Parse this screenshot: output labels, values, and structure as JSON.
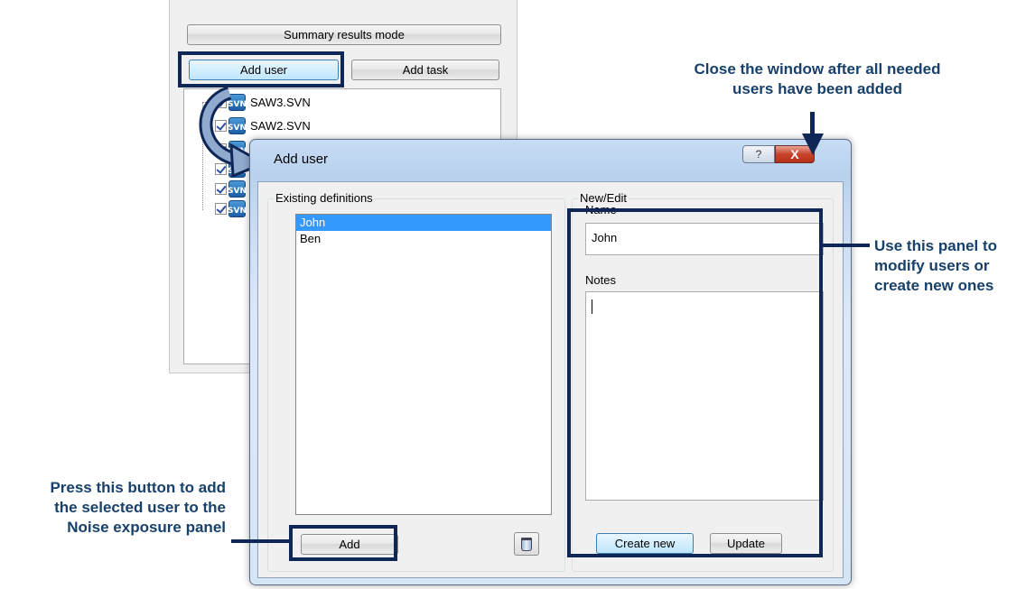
{
  "background_panel": {
    "summary_button": "Summary results mode",
    "add_user_button": "Add user",
    "add_task_button": "Add task",
    "tree_items": [
      "SAW3.SVN",
      "SAW2.SVN",
      "",
      "",
      "",
      ""
    ],
    "file_icon_text": "SVN"
  },
  "dialog": {
    "title": "Add user",
    "help_glyph": "?",
    "close_glyph": "X",
    "existing_group_title": "Existing definitions",
    "existing_users": [
      "John",
      "Ben"
    ],
    "selected_user": "John",
    "add_button": "Add",
    "newedit_group_title": "New/Edit",
    "name_label": "Name",
    "name_value": "John",
    "notes_label": "Notes",
    "notes_value": "",
    "create_new_button": "Create new",
    "update_button": "Update"
  },
  "annotations": {
    "close_hint_line1": "Close the window after all needed",
    "close_hint_line2": "users have been added",
    "panel_hint_line1": "Use this panel to",
    "panel_hint_line2": "modify users or",
    "panel_hint_line3": "create new ones",
    "add_hint_line1": "Press this button to add",
    "add_hint_line2": "the selected user to the",
    "add_hint_line3": "Noise exposure panel"
  },
  "colors": {
    "annotation_text": "#17406b",
    "highlight_border": "#0f2757",
    "selection": "#3399ff"
  }
}
